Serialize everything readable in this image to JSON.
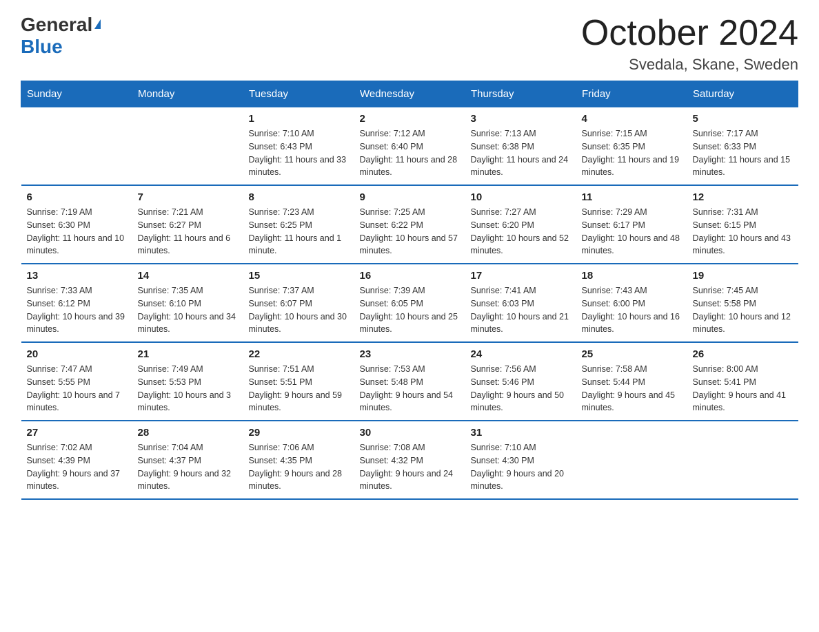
{
  "header": {
    "logo_general": "General",
    "logo_blue": "Blue",
    "month_title": "October 2024",
    "location": "Svedala, Skane, Sweden"
  },
  "weekdays": [
    "Sunday",
    "Monday",
    "Tuesday",
    "Wednesday",
    "Thursday",
    "Friday",
    "Saturday"
  ],
  "weeks": [
    [
      {
        "day": "",
        "sunrise": "",
        "sunset": "",
        "daylight": ""
      },
      {
        "day": "",
        "sunrise": "",
        "sunset": "",
        "daylight": ""
      },
      {
        "day": "1",
        "sunrise": "Sunrise: 7:10 AM",
        "sunset": "Sunset: 6:43 PM",
        "daylight": "Daylight: 11 hours and 33 minutes."
      },
      {
        "day": "2",
        "sunrise": "Sunrise: 7:12 AM",
        "sunset": "Sunset: 6:40 PM",
        "daylight": "Daylight: 11 hours and 28 minutes."
      },
      {
        "day": "3",
        "sunrise": "Sunrise: 7:13 AM",
        "sunset": "Sunset: 6:38 PM",
        "daylight": "Daylight: 11 hours and 24 minutes."
      },
      {
        "day": "4",
        "sunrise": "Sunrise: 7:15 AM",
        "sunset": "Sunset: 6:35 PM",
        "daylight": "Daylight: 11 hours and 19 minutes."
      },
      {
        "day": "5",
        "sunrise": "Sunrise: 7:17 AM",
        "sunset": "Sunset: 6:33 PM",
        "daylight": "Daylight: 11 hours and 15 minutes."
      }
    ],
    [
      {
        "day": "6",
        "sunrise": "Sunrise: 7:19 AM",
        "sunset": "Sunset: 6:30 PM",
        "daylight": "Daylight: 11 hours and 10 minutes."
      },
      {
        "day": "7",
        "sunrise": "Sunrise: 7:21 AM",
        "sunset": "Sunset: 6:27 PM",
        "daylight": "Daylight: 11 hours and 6 minutes."
      },
      {
        "day": "8",
        "sunrise": "Sunrise: 7:23 AM",
        "sunset": "Sunset: 6:25 PM",
        "daylight": "Daylight: 11 hours and 1 minute."
      },
      {
        "day": "9",
        "sunrise": "Sunrise: 7:25 AM",
        "sunset": "Sunset: 6:22 PM",
        "daylight": "Daylight: 10 hours and 57 minutes."
      },
      {
        "day": "10",
        "sunrise": "Sunrise: 7:27 AM",
        "sunset": "Sunset: 6:20 PM",
        "daylight": "Daylight: 10 hours and 52 minutes."
      },
      {
        "day": "11",
        "sunrise": "Sunrise: 7:29 AM",
        "sunset": "Sunset: 6:17 PM",
        "daylight": "Daylight: 10 hours and 48 minutes."
      },
      {
        "day": "12",
        "sunrise": "Sunrise: 7:31 AM",
        "sunset": "Sunset: 6:15 PM",
        "daylight": "Daylight: 10 hours and 43 minutes."
      }
    ],
    [
      {
        "day": "13",
        "sunrise": "Sunrise: 7:33 AM",
        "sunset": "Sunset: 6:12 PM",
        "daylight": "Daylight: 10 hours and 39 minutes."
      },
      {
        "day": "14",
        "sunrise": "Sunrise: 7:35 AM",
        "sunset": "Sunset: 6:10 PM",
        "daylight": "Daylight: 10 hours and 34 minutes."
      },
      {
        "day": "15",
        "sunrise": "Sunrise: 7:37 AM",
        "sunset": "Sunset: 6:07 PM",
        "daylight": "Daylight: 10 hours and 30 minutes."
      },
      {
        "day": "16",
        "sunrise": "Sunrise: 7:39 AM",
        "sunset": "Sunset: 6:05 PM",
        "daylight": "Daylight: 10 hours and 25 minutes."
      },
      {
        "day": "17",
        "sunrise": "Sunrise: 7:41 AM",
        "sunset": "Sunset: 6:03 PM",
        "daylight": "Daylight: 10 hours and 21 minutes."
      },
      {
        "day": "18",
        "sunrise": "Sunrise: 7:43 AM",
        "sunset": "Sunset: 6:00 PM",
        "daylight": "Daylight: 10 hours and 16 minutes."
      },
      {
        "day": "19",
        "sunrise": "Sunrise: 7:45 AM",
        "sunset": "Sunset: 5:58 PM",
        "daylight": "Daylight: 10 hours and 12 minutes."
      }
    ],
    [
      {
        "day": "20",
        "sunrise": "Sunrise: 7:47 AM",
        "sunset": "Sunset: 5:55 PM",
        "daylight": "Daylight: 10 hours and 7 minutes."
      },
      {
        "day": "21",
        "sunrise": "Sunrise: 7:49 AM",
        "sunset": "Sunset: 5:53 PM",
        "daylight": "Daylight: 10 hours and 3 minutes."
      },
      {
        "day": "22",
        "sunrise": "Sunrise: 7:51 AM",
        "sunset": "Sunset: 5:51 PM",
        "daylight": "Daylight: 9 hours and 59 minutes."
      },
      {
        "day": "23",
        "sunrise": "Sunrise: 7:53 AM",
        "sunset": "Sunset: 5:48 PM",
        "daylight": "Daylight: 9 hours and 54 minutes."
      },
      {
        "day": "24",
        "sunrise": "Sunrise: 7:56 AM",
        "sunset": "Sunset: 5:46 PM",
        "daylight": "Daylight: 9 hours and 50 minutes."
      },
      {
        "day": "25",
        "sunrise": "Sunrise: 7:58 AM",
        "sunset": "Sunset: 5:44 PM",
        "daylight": "Daylight: 9 hours and 45 minutes."
      },
      {
        "day": "26",
        "sunrise": "Sunrise: 8:00 AM",
        "sunset": "Sunset: 5:41 PM",
        "daylight": "Daylight: 9 hours and 41 minutes."
      }
    ],
    [
      {
        "day": "27",
        "sunrise": "Sunrise: 7:02 AM",
        "sunset": "Sunset: 4:39 PM",
        "daylight": "Daylight: 9 hours and 37 minutes."
      },
      {
        "day": "28",
        "sunrise": "Sunrise: 7:04 AM",
        "sunset": "Sunset: 4:37 PM",
        "daylight": "Daylight: 9 hours and 32 minutes."
      },
      {
        "day": "29",
        "sunrise": "Sunrise: 7:06 AM",
        "sunset": "Sunset: 4:35 PM",
        "daylight": "Daylight: 9 hours and 28 minutes."
      },
      {
        "day": "30",
        "sunrise": "Sunrise: 7:08 AM",
        "sunset": "Sunset: 4:32 PM",
        "daylight": "Daylight: 9 hours and 24 minutes."
      },
      {
        "day": "31",
        "sunrise": "Sunrise: 7:10 AM",
        "sunset": "Sunset: 4:30 PM",
        "daylight": "Daylight: 9 hours and 20 minutes."
      },
      {
        "day": "",
        "sunrise": "",
        "sunset": "",
        "daylight": ""
      },
      {
        "day": "",
        "sunrise": "",
        "sunset": "",
        "daylight": ""
      }
    ]
  ]
}
